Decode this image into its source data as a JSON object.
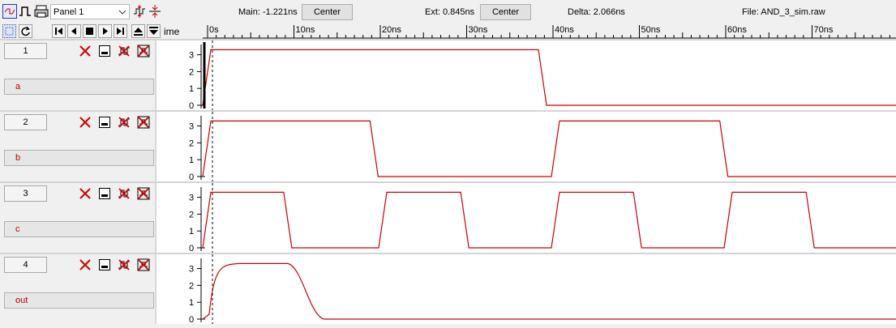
{
  "toolbar": {
    "panel_select": "Panel 1",
    "main_readout": "Main: -1.221ns",
    "main_center_label": "Center",
    "ext_readout": "Ext: 0.845ns",
    "ext_center_label": "Center",
    "delta_readout": "Delta: 2.066ns",
    "file_readout": "File: AND_3_sim.raw"
  },
  "time_axis": {
    "label": "ime",
    "ticks": [
      "0s",
      "10ns",
      "20ns",
      "30ns",
      "40ns",
      "50ns",
      "60ns",
      "70ns"
    ]
  },
  "y_ticks": [
    "3",
    "2",
    "1",
    "0"
  ],
  "tracks": [
    {
      "number": "1",
      "signal": "a"
    },
    {
      "number": "2",
      "signal": "b"
    },
    {
      "number": "3",
      "signal": "c"
    },
    {
      "number": "4",
      "signal": "out"
    }
  ],
  "colors": {
    "waveform": "#cc0000",
    "cursor": "#000000",
    "background": "#ffffff"
  }
}
